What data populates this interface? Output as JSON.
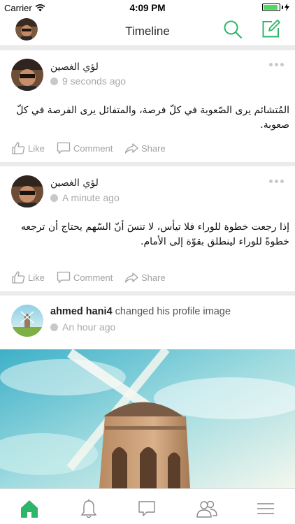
{
  "status_bar": {
    "carrier": "Carrier",
    "time": "4:09 PM",
    "battery_level": 0.9
  },
  "nav": {
    "title": "Timeline"
  },
  "posts": [
    {
      "author": "لؤي الغصين",
      "time": "9 seconds ago",
      "text": "المُتشائم يرى الصّعوبة في كلّ فرصة، والمتفائل يرى الفرصة في كلّ صعوبة.",
      "like": "Like",
      "comment": "Comment",
      "share": "Share"
    },
    {
      "author": "لؤي الغصين",
      "time": "A minute ago",
      "text": "إذا رجعت خطوة للوراء فلا تيأس، لا تنسَ أنّ السّهم يحتاج أن ترجعه خطوةً للوراء لينطلق بقوّة إلى الأمام.",
      "like": "Like",
      "comment": "Comment",
      "share": "Share"
    },
    {
      "author": "ahmed hani4",
      "action": "changed his profile image",
      "time": "An hour ago"
    }
  ],
  "tabbar": {
    "items": [
      "home-icon",
      "bell-icon",
      "chat-icon",
      "friends-icon",
      "menu-icon"
    ],
    "active": "home-icon"
  },
  "colors": {
    "accent": "#2fb56a",
    "muted": "#a3a3a3",
    "separator": "#ebebeb"
  }
}
